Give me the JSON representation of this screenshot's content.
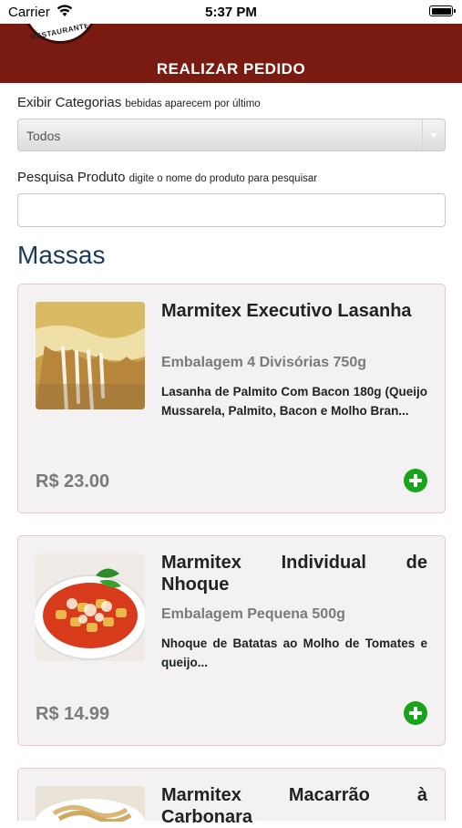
{
  "status_bar": {
    "carrier": "Carrier",
    "time": "5:37 PM"
  },
  "header": {
    "logo_text": "RESTAURANTE",
    "title": "REALIZAR PEDIDO"
  },
  "filters": {
    "categories_label": "Exibir Categorias",
    "categories_hint": "bebidas aparecem por último",
    "categories_selected": "Todos",
    "search_label": "Pesquisa Produto",
    "search_hint": "digite o nome do produto para pesquisar",
    "search_value": ""
  },
  "section": {
    "title": "Massas"
  },
  "products": [
    {
      "name": "Marmitex Executivo Lasanha",
      "packaging": "Embalagem 4 Divisórias 750g",
      "description": "Lasanha de Palmito Com Bacon 180g (Queijo Mussarela, Palmito, Bacon e Molho Bran...",
      "price": "R$ 23.00",
      "image": "lasagna-photo"
    },
    {
      "name": "Marmitex Individual de Nhoque",
      "packaging": "Embalagem Pequena 500g",
      "description": "Nhoque de Batatas ao Molho de Tomates e queijo...",
      "price": "R$ 14.99",
      "image": "gnocchi-photo"
    },
    {
      "name": "Marmitex Macarrão à Carbonara",
      "image": "carbonara-photo"
    }
  ],
  "colors": {
    "header_bg": "#7a1b12",
    "section_title": "#1a3a5c",
    "add_button": "#19a31a",
    "card_bg": "#f3f1f1",
    "card_border": "#e8c8c8"
  }
}
